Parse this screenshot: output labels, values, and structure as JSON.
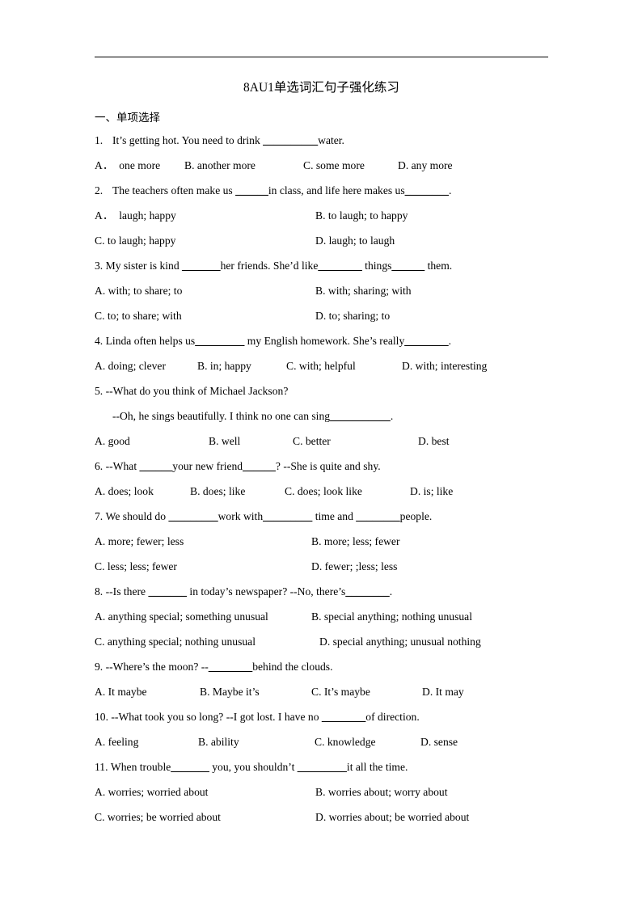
{
  "document": {
    "title": "8AU1单选词汇句子强化练习",
    "section_heading": "一、单项选择"
  },
  "questions": [
    {
      "number": "1.",
      "stem_pre": "It’s getting hot. You need to drink ",
      "blank1": "__________",
      "stem_post": "water.",
      "layout": "four-col-a",
      "options": [
        {
          "label": "A．",
          "text": "one more"
        },
        {
          "label": "B.",
          "text": "another more"
        },
        {
          "label": "C.",
          "text": "some more"
        },
        {
          "label": "D.",
          "text": "any more"
        }
      ]
    },
    {
      "number": "2.",
      "stem_pre": "The teachers often make us ",
      "blank1": "______",
      "stem_mid": "in class, and life here makes us",
      "blank2": "________",
      "stem_post": ".",
      "layout": "two-col",
      "options": [
        {
          "label": "A．",
          "text": "laugh; happy"
        },
        {
          "label": "B.",
          "text": "to laugh; to happy"
        },
        {
          "label": "C.",
          "text": "to laugh; happy"
        },
        {
          "label": "D.",
          "text": "laugh; to laugh"
        }
      ]
    },
    {
      "number": "3.",
      "stem_pre": "My sister is kind ",
      "blank1": "_______",
      "stem_mid": "her friends. She’d like",
      "blank2": "________",
      "stem_mid2": " things",
      "blank3": "______",
      "stem_post": " them.",
      "layout": "two-col",
      "options": [
        {
          "label": "A.",
          "text": "with; to share; to"
        },
        {
          "label": "B.",
          "text": "with; sharing; with"
        },
        {
          "label": "C.",
          "text": "to; to share; with"
        },
        {
          "label": "D.",
          "text": "to; sharing; to"
        }
      ]
    },
    {
      "number": "4.",
      "stem_pre": "Linda often helps us",
      "blank1": "_________",
      "stem_mid": " my English homework. She’s really",
      "blank2": "________",
      "stem_post": ".",
      "layout": "four-col-b",
      "options": [
        {
          "label": "A.",
          "text": "doing; clever"
        },
        {
          "label": "B.",
          "text": "in; happy"
        },
        {
          "label": "C.",
          "text": "with; helpful"
        },
        {
          "label": "D.",
          "text": "with; interesting"
        }
      ]
    },
    {
      "number": "5.",
      "stem_pre": "--What do you think of Michael Jackson?",
      "stem_line2_pre": "--Oh, he sings beautifully. I think no one can sing",
      "blank1": "___________",
      "stem_post": ".",
      "layout": "four-col-c",
      "options": [
        {
          "label": "A.",
          "text": "good"
        },
        {
          "label": "B.",
          "text": "well"
        },
        {
          "label": "C.",
          "text": "better"
        },
        {
          "label": "D.",
          "text": "best"
        }
      ]
    },
    {
      "number": "6.",
      "stem_pre": "--What ",
      "blank1": "______",
      "stem_mid": "your new friend",
      "blank2": "______",
      "stem_post": "? --She is quite and shy.",
      "layout": "four-col-d",
      "options": [
        {
          "label": "A.",
          "text": "does; look"
        },
        {
          "label": "B.",
          "text": "does; like"
        },
        {
          "label": "C.",
          "text": "does; look like"
        },
        {
          "label": "D.",
          "text": "is; like"
        }
      ]
    },
    {
      "number": "7.",
      "stem_pre": "We should do ",
      "blank1": "_________",
      "stem_mid": "work with",
      "blank2": "_________",
      "stem_mid2": " time and ",
      "blank3": "________",
      "stem_post": "people.",
      "layout": "two-col",
      "options": [
        {
          "label": "A.",
          "text": "more; fewer; less"
        },
        {
          "label": "B.",
          "text": "more; less; fewer"
        },
        {
          "label": "C.",
          "text": "less; less; fewer"
        },
        {
          "label": "D.",
          "text": "fewer; ;less; less"
        }
      ]
    },
    {
      "number": "8.",
      "stem_pre": "--Is there ",
      "blank1": "_______",
      "stem_mid": " in today’s newspaper? --No, there’s",
      "blank2": "________",
      "stem_post": ".",
      "layout": "two-col-wide",
      "options": [
        {
          "label": "A.",
          "text": "anything special; something unusual"
        },
        {
          "label": "B.",
          "text": "special anything; nothing unusual"
        },
        {
          "label": "C.",
          "text": "anything special; nothing unusual"
        },
        {
          "label": "D.",
          "text": "special anything; unusual nothing"
        }
      ]
    },
    {
      "number": "9.",
      "stem_pre": "--Where’s the moon? --",
      "blank1": "________",
      "stem_post": "behind the clouds.",
      "layout": "four-col-e",
      "options": [
        {
          "label": "A.",
          "text": "It maybe"
        },
        {
          "label": "B.",
          "text": "Maybe it’s"
        },
        {
          "label": "C.",
          "text": "It’s maybe"
        },
        {
          "label": "D.",
          "text": "It may"
        }
      ]
    },
    {
      "number": "10.",
      "stem_pre": "--What took you so long? --I got lost. I have no ",
      "blank1": "________",
      "stem_post": "of direction.",
      "layout": "four-col-f",
      "options": [
        {
          "label": "A.",
          "text": "feeling"
        },
        {
          "label": "B.",
          "text": "ability"
        },
        {
          "label": "C.",
          "text": "knowledge"
        },
        {
          "label": "D.",
          "text": "sense"
        }
      ]
    },
    {
      "number": "11.",
      "stem_pre": "When trouble",
      "blank1": "_______",
      "stem_mid": " you, you shouldn’t ",
      "blank2": "_________",
      "stem_post": "it all the time.",
      "layout": "two-col",
      "options": [
        {
          "label": "A.",
          "text": "worries; worried about"
        },
        {
          "label": "B.",
          "text": "worries about; worry about"
        },
        {
          "label": "C.",
          "text": "worries; be worried about"
        },
        {
          "label": "D.",
          "text": "worries about; be worried about"
        }
      ]
    }
  ]
}
